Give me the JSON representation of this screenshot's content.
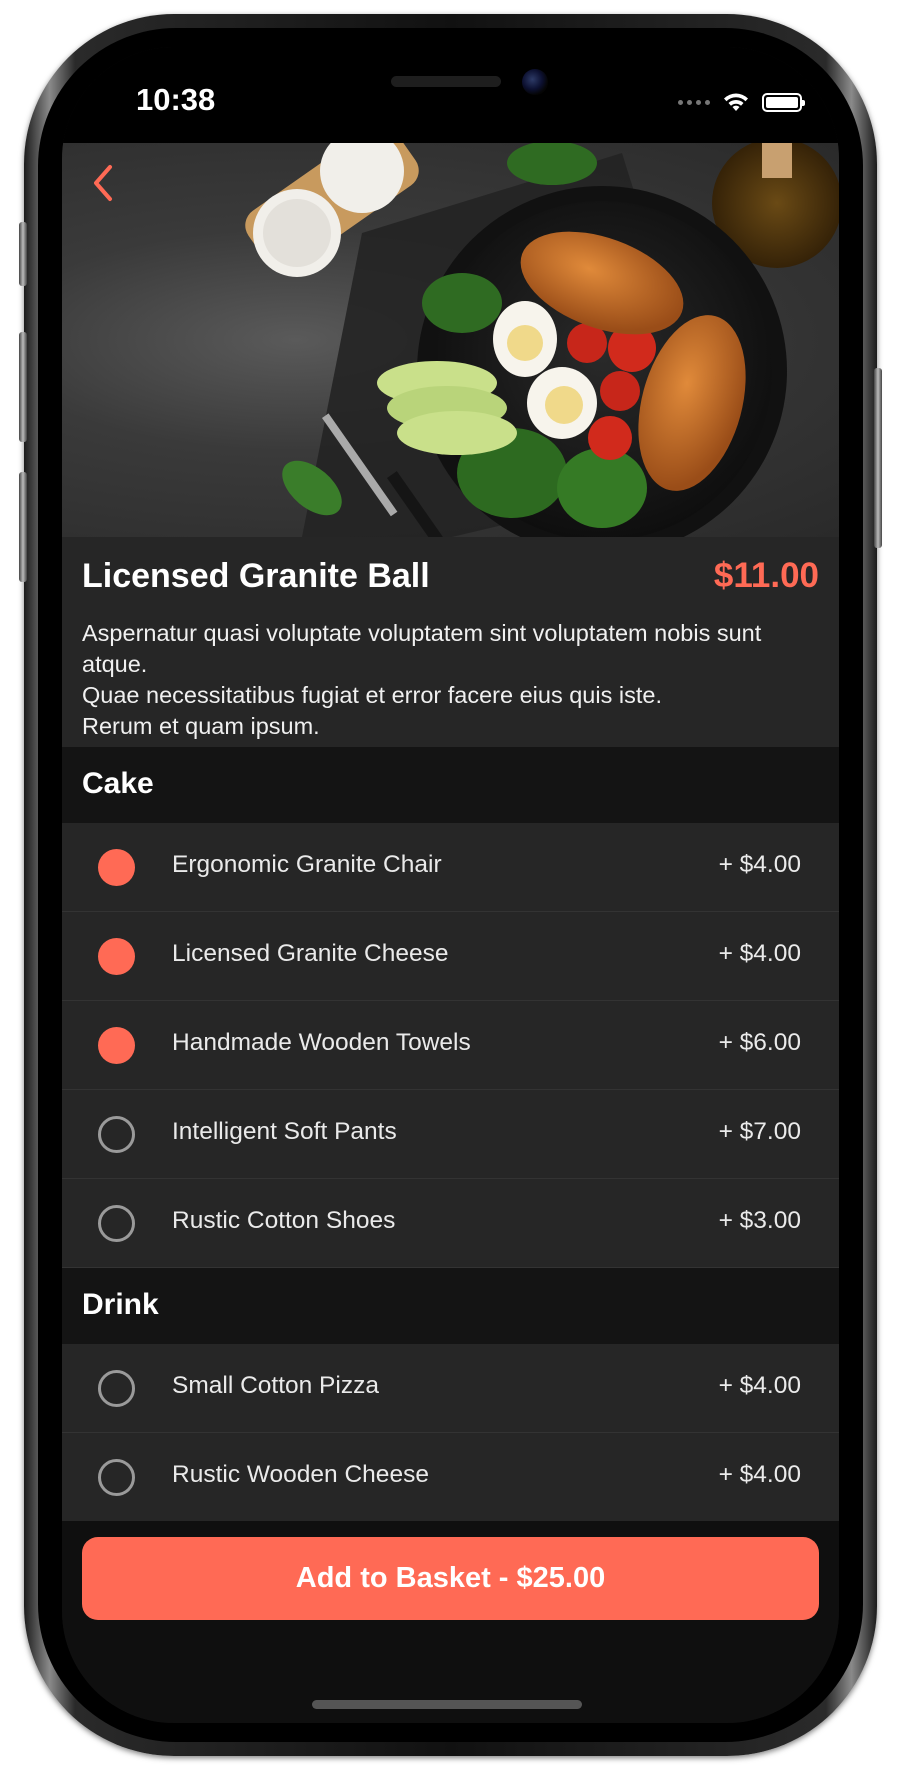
{
  "status_bar": {
    "time": "10:38"
  },
  "product": {
    "name": "Licensed Granite Ball",
    "price": "$11.00",
    "description": "Aspernatur quasi voluptate voluptatem sint voluptatem nobis sunt atque.\nQuae necessitatibus fugiat et error facere eius quis iste.\nRerum et quam ipsum."
  },
  "sections": [
    {
      "title": "Cake",
      "options": [
        {
          "label": "Ergonomic Granite Chair",
          "price": "+ $4.00",
          "selected": true
        },
        {
          "label": "Licensed Granite Cheese",
          "price": "+ $4.00",
          "selected": true
        },
        {
          "label": "Handmade Wooden Towels",
          "price": "+ $6.00",
          "selected": true
        },
        {
          "label": "Intelligent Soft Pants",
          "price": "+ $7.00",
          "selected": false
        },
        {
          "label": "Rustic Cotton Shoes",
          "price": "+ $3.00",
          "selected": false
        }
      ]
    },
    {
      "title": "Drink",
      "options": [
        {
          "label": "Small Cotton Pizza",
          "price": "+ $4.00",
          "selected": false
        },
        {
          "label": "Rustic Wooden Cheese",
          "price": "+ $4.00",
          "selected": false
        }
      ]
    }
  ],
  "cart": {
    "add_button_label": "Add to Basket - $25.00"
  },
  "colors": {
    "accent": "#ff6a55",
    "row_bg": "#262626",
    "section_bg": "#141414"
  },
  "icons": {
    "back": "chevron-left-icon",
    "wifi": "wifi-icon",
    "battery": "battery-icon",
    "signal": "signal-dots-icon"
  }
}
